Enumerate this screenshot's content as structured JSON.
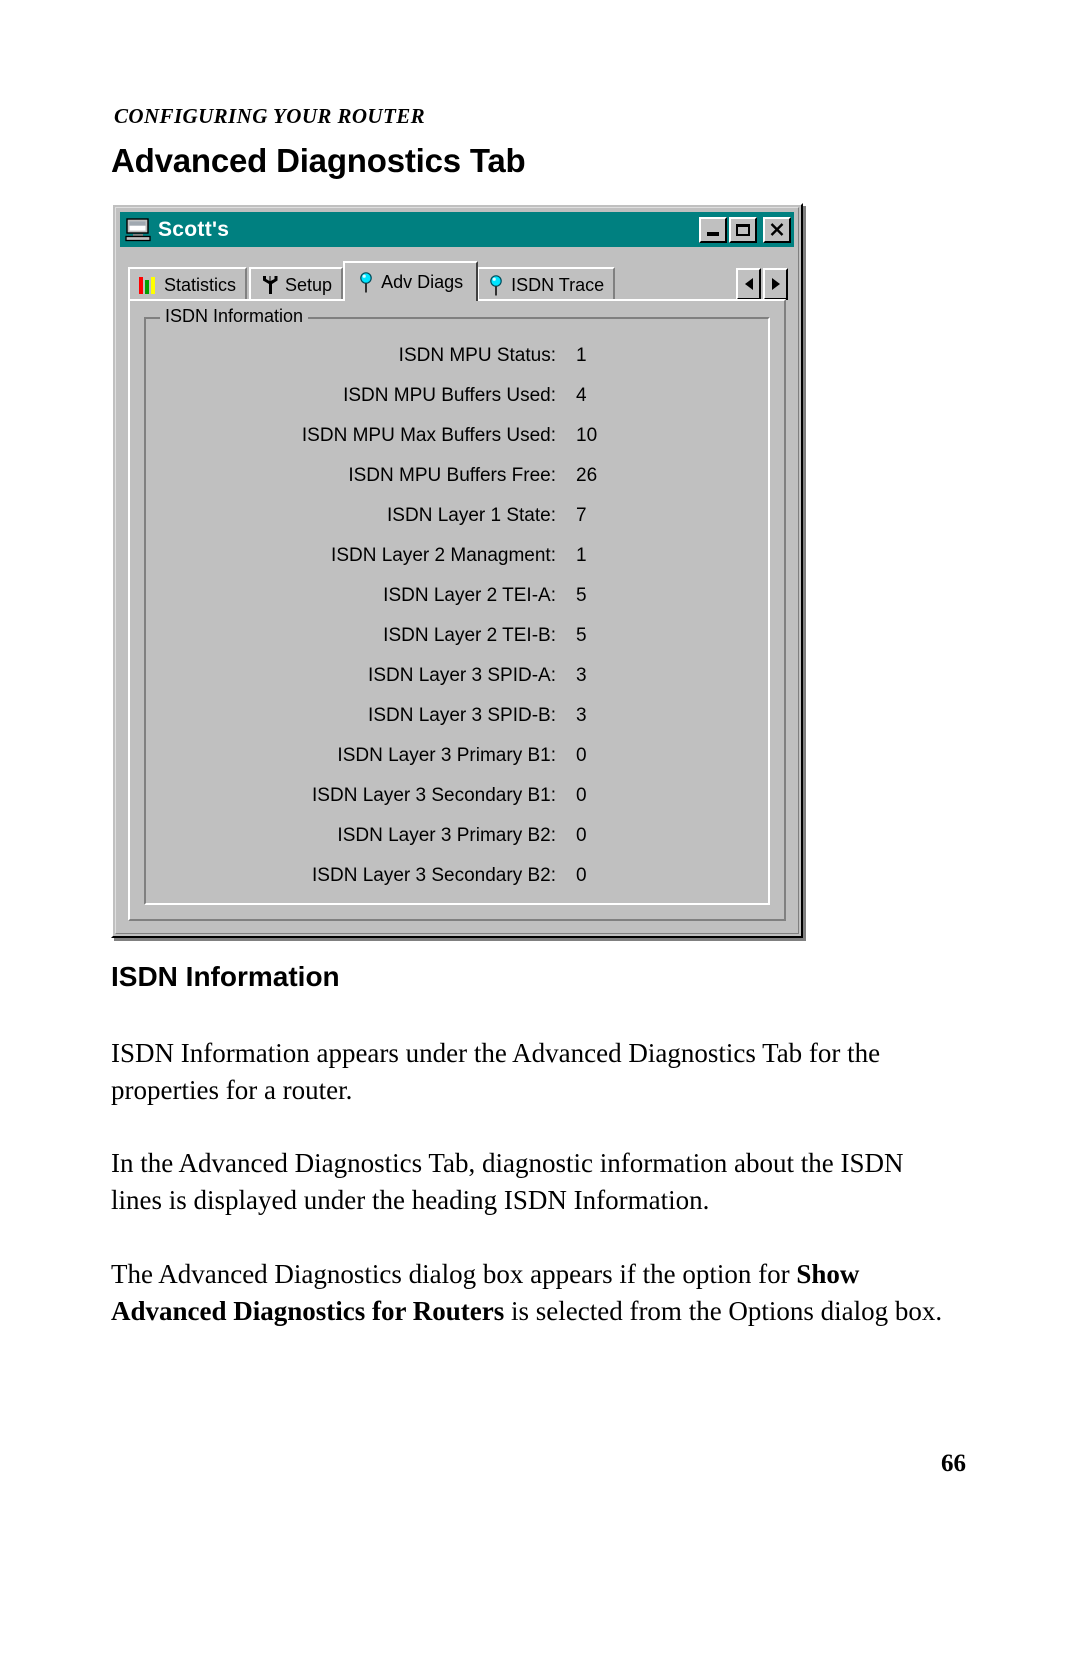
{
  "document": {
    "running_head": "CONFIGURING YOUR ROUTER",
    "chapter_title": "Advanced Diagnostics Tab",
    "page_number": "66"
  },
  "dialog": {
    "title": "Scott's",
    "title_icon": "computer-icon",
    "titlebar_color": "#008080",
    "face_color": "#c0c0c0",
    "window_buttons": [
      {
        "name": "minimize-button",
        "label": "_"
      },
      {
        "name": "maximize-button",
        "label": "□"
      },
      {
        "name": "close-button",
        "label": "×"
      }
    ],
    "tabs": [
      {
        "label": "Statistics",
        "icon": "bar-chart-icon",
        "active": false
      },
      {
        "label": "Setup",
        "icon": "wrench-icon",
        "active": false
      },
      {
        "label": "Adv Diags",
        "icon": "pin-icon",
        "active": true
      },
      {
        "label": "ISDN Trace",
        "icon": "pin-icon",
        "active": false
      }
    ],
    "tab_scroll": {
      "left_label": "◀",
      "right_label": "▶"
    },
    "group": {
      "title": "ISDN Information",
      "rows": [
        {
          "label": "ISDN MPU Status:",
          "value": "1"
        },
        {
          "label": "ISDN MPU Buffers Used:",
          "value": "4"
        },
        {
          "label": "ISDN MPU Max Buffers Used:",
          "value": "10"
        },
        {
          "label": "ISDN MPU Buffers Free:",
          "value": "26"
        },
        {
          "label": "ISDN Layer 1 State:",
          "value": "7"
        },
        {
          "label": "ISDN Layer 2 Managment:",
          "value": "1"
        },
        {
          "label": "ISDN Layer 2 TEI-A:",
          "value": "5"
        },
        {
          "label": "ISDN Layer 2 TEI-B:",
          "value": "5"
        },
        {
          "label": "ISDN Layer 3 SPID-A:",
          "value": "3"
        },
        {
          "label": "ISDN Layer 3 SPID-B:",
          "value": "3"
        },
        {
          "label": "ISDN Layer 3 Primary B1:",
          "value": "0"
        },
        {
          "label": "ISDN Layer 3 Secondary B1:",
          "value": "0"
        },
        {
          "label": "ISDN Layer 3 Primary B2:",
          "value": "0"
        },
        {
          "label": "ISDN Layer 3 Secondary B2:",
          "value": "0"
        }
      ]
    }
  },
  "body": {
    "section_heading": "ISDN Information",
    "paragraph_1": "ISDN Information appears under the Advanced Diagnostics Tab for the properties for a router.",
    "paragraph_2": "In the Advanced Diagnostics Tab, diagnostic information about the ISDN lines is displayed under the heading ISDN Information.",
    "paragraph_3_before": "The Advanced Diagnostics dialog box appears if the option for ",
    "paragraph_3_bold": "Show Advanced Diagnostics for Routers",
    "paragraph_3_after": " is selected from the Options dialog box."
  }
}
